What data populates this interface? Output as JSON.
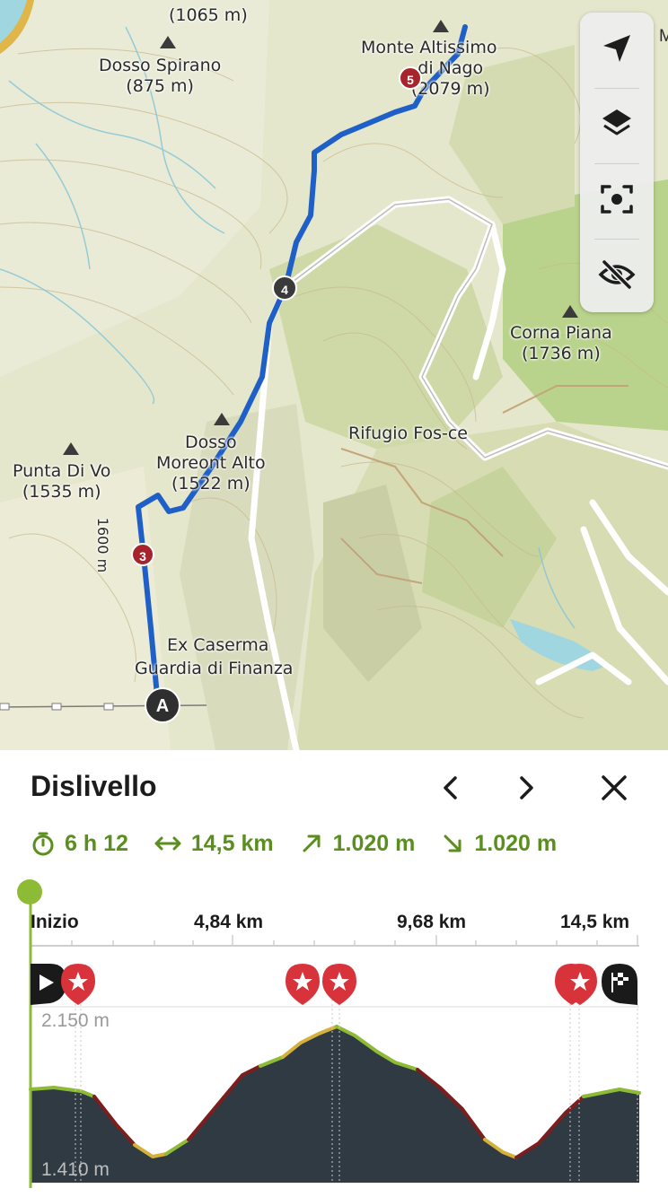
{
  "map": {
    "peaks": [
      {
        "name": "(1065 m)",
        "elev": ""
      },
      {
        "name": "Dosso Spirano",
        "elev": "(875 m)"
      },
      {
        "name": "Monte Altissimo",
        "elev": "di Nago",
        "elev2": "(2079 m)"
      },
      {
        "name": "Corna Piana",
        "elev": "(1736 m)"
      },
      {
        "name": "Dosso",
        "elev": "Moreont Alto",
        "elev2": "(1522 m)"
      },
      {
        "name": "Punta Di Vo",
        "elev": "(1535 m)"
      }
    ],
    "places": {
      "rifugio": "Rifugio Fos-ce",
      "caserma_line1": "Ex Caserma",
      "caserma_line2": "Guardia di Finanza",
      "contour": "1600 m",
      "edge_letter": "M"
    },
    "waypoints": {
      "w3": "3",
      "w4": "4",
      "w5": "5",
      "start": "A"
    },
    "controls": [
      "navigate-icon",
      "layers-icon",
      "focus-icon",
      "hide-icon"
    ],
    "colors": {
      "route": "#1f5fc8",
      "road": "#ffffff",
      "water": "#9fd6e0",
      "terrain": "#e7e8cf"
    }
  },
  "panel": {
    "title": "Dislivello",
    "stats": {
      "duration": "6 h 12",
      "distance": "14,5 km",
      "ascent": "1.020 m",
      "descent": "1.020 m"
    },
    "accent_color": "#5a8f1e"
  },
  "profile": {
    "x_labels": [
      "Inizio",
      "4,84 km",
      "9,68 km",
      "14,5 km"
    ],
    "elev_max": "2.150 m",
    "elev_min": "1.410 m",
    "markers": [
      "start-flag",
      "star",
      "star",
      "star",
      "star",
      "finish-flag"
    ],
    "colors": {
      "fill": "#2f3a43",
      "grade_easy": "#8dbb35",
      "grade_mid": "#d4b13a",
      "grade_steep": "#7d1d1d",
      "cursor": "#8dbb35"
    }
  }
}
